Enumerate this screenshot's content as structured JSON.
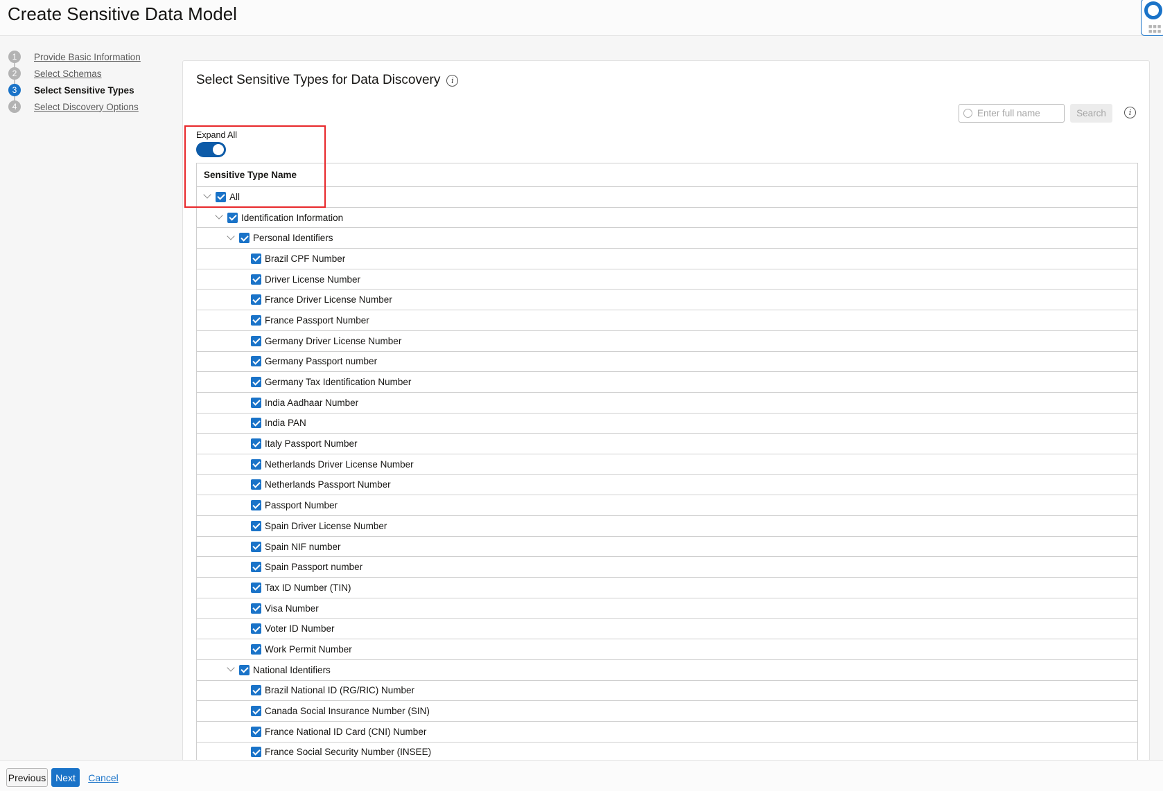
{
  "header": {
    "title": "Create Sensitive Data Model"
  },
  "steps": [
    {
      "num": "1",
      "label": "Provide Basic Information",
      "state": "link"
    },
    {
      "num": "2",
      "label": "Select Schemas",
      "state": "link"
    },
    {
      "num": "3",
      "label": "Select Sensitive Types",
      "state": "active"
    },
    {
      "num": "4",
      "label": "Select Discovery Options",
      "state": "link"
    }
  ],
  "panel": {
    "title": "Select Sensitive Types for Data Discovery",
    "search_placeholder": "Enter full name",
    "search_value": "",
    "search_button": "Search",
    "expand_all_label": "Expand All",
    "expand_all_on": true,
    "column_header": "Sensitive Type Name"
  },
  "rows": [
    {
      "level": 0,
      "label": "All",
      "expandable": true
    },
    {
      "level": 1,
      "label": "Identification Information",
      "expandable": true
    },
    {
      "level": 2,
      "label": "Personal Identifiers",
      "expandable": true
    },
    {
      "level": 3,
      "label": "Brazil CPF Number"
    },
    {
      "level": 3,
      "label": "Driver License Number"
    },
    {
      "level": 3,
      "label": "France Driver License Number"
    },
    {
      "level": 3,
      "label": "France Passport Number"
    },
    {
      "level": 3,
      "label": "Germany Driver License Number"
    },
    {
      "level": 3,
      "label": "Germany Passport number"
    },
    {
      "level": 3,
      "label": "Germany Tax Identification Number"
    },
    {
      "level": 3,
      "label": "India Aadhaar Number"
    },
    {
      "level": 3,
      "label": "India PAN"
    },
    {
      "level": 3,
      "label": "Italy Passport Number"
    },
    {
      "level": 3,
      "label": "Netherlands Driver License Number"
    },
    {
      "level": 3,
      "label": "Netherlands Passport Number"
    },
    {
      "level": 3,
      "label": "Passport Number"
    },
    {
      "level": 3,
      "label": "Spain Driver License Number"
    },
    {
      "level": 3,
      "label": "Spain NIF number"
    },
    {
      "level": 3,
      "label": "Spain Passport number"
    },
    {
      "level": 3,
      "label": "Tax ID Number (TIN)"
    },
    {
      "level": 3,
      "label": "Visa Number"
    },
    {
      "level": 3,
      "label": "Voter ID Number"
    },
    {
      "level": 3,
      "label": "Work Permit Number"
    },
    {
      "level": 2,
      "label": "National Identifiers",
      "expandable": true
    },
    {
      "level": 3,
      "label": "Brazil National ID (RG/RIC) Number"
    },
    {
      "level": 3,
      "label": "Canada Social Insurance Number (SIN)"
    },
    {
      "level": 3,
      "label": "France National ID Card (CNI) Number"
    },
    {
      "level": 3,
      "label": "France Social Security Number (INSEE)"
    }
  ],
  "footer": {
    "previous": "Previous",
    "next": "Next",
    "cancel": "Cancel"
  },
  "colors": {
    "accent": "#1a73c8",
    "highlight": "#e8282b"
  }
}
